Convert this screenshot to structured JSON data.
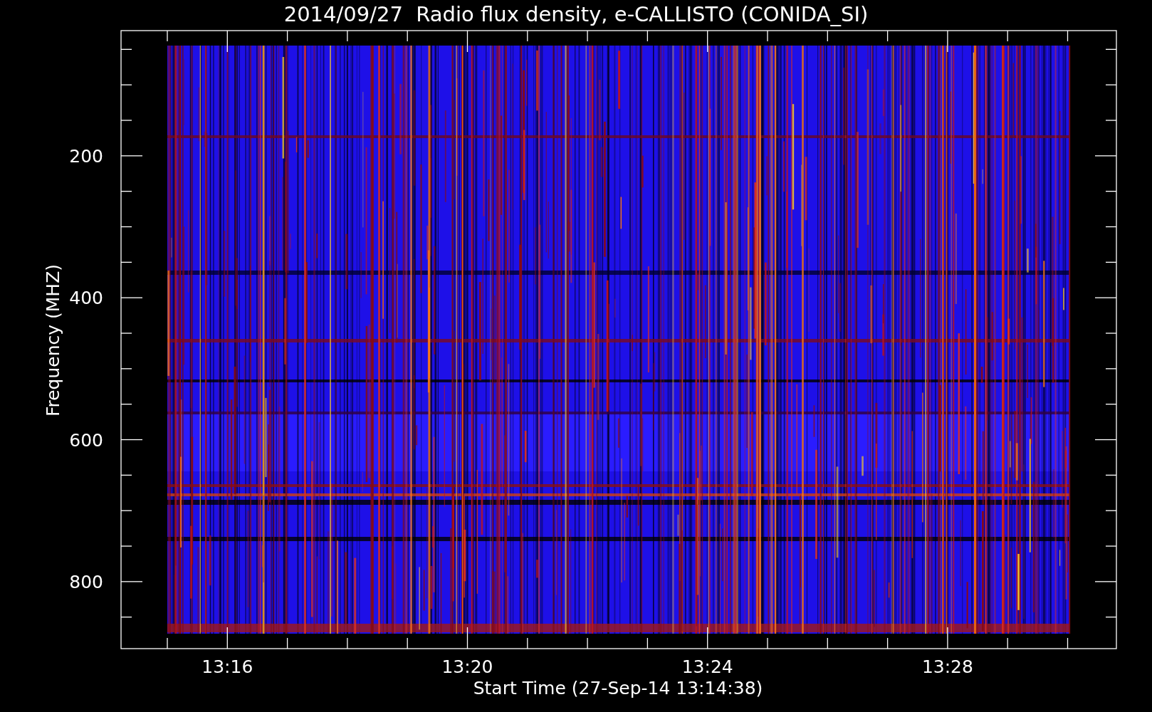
{
  "title": "2014/09/27  Radio flux density, e-CALLISTO (CONIDA_SI)",
  "y_axis": {
    "label": "Frequency (MHZ)",
    "ticks": [
      "200",
      "400",
      "600",
      "800"
    ]
  },
  "x_axis": {
    "label": "Start Time (27-Sep-14 13:14:38)",
    "ticks": [
      "13:16",
      "13:20",
      "13:24",
      "13:28"
    ]
  }
}
